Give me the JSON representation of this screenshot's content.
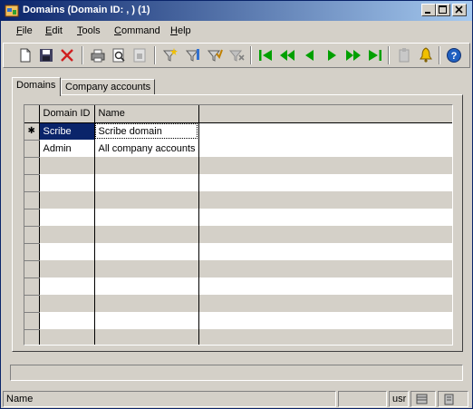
{
  "window": {
    "title": "Domains (Domain ID: , ) (1)",
    "caption_buttons": [
      "minimize",
      "maximize",
      "close"
    ]
  },
  "menu": [
    {
      "label": "File",
      "u": "F",
      "rest": "ile"
    },
    {
      "label": "Edit",
      "u": "E",
      "rest": "dit"
    },
    {
      "label": "Tools",
      "u": "T",
      "rest": "ools"
    },
    {
      "label": "Command",
      "u": "C",
      "rest": "ommand"
    },
    {
      "label": "Help",
      "u": "H",
      "rest": "elp"
    }
  ],
  "toolbar": {
    "buttons": [
      "new-icon",
      "save-icon",
      "delete-icon",
      "print-icon",
      "print-preview-icon",
      "export-icon",
      "filter-icon",
      "filter-edit-icon",
      "filter-apply-icon",
      "filter-clear-icon",
      "first-record-icon",
      "previous-page-icon",
      "previous-record-icon",
      "next-record-icon",
      "next-page-icon",
      "last-record-icon",
      "clipboard-icon",
      "alert-icon",
      "help-icon"
    ],
    "accent": "#00a000"
  },
  "tabs": [
    {
      "label": "Domains",
      "active": true
    },
    {
      "label": "Company accounts",
      "active": false
    }
  ],
  "grid": {
    "columns": [
      "Domain ID",
      "Name"
    ],
    "rows": [
      {
        "indicator": "✱",
        "domain_id": "Scribe",
        "name": "Scribe domain"
      },
      {
        "indicator": "",
        "domain_id": "Admin",
        "name": "All company accounts"
      }
    ],
    "selection_color": "#0a246a"
  },
  "status": {
    "field": "Name",
    "user": "usr"
  }
}
